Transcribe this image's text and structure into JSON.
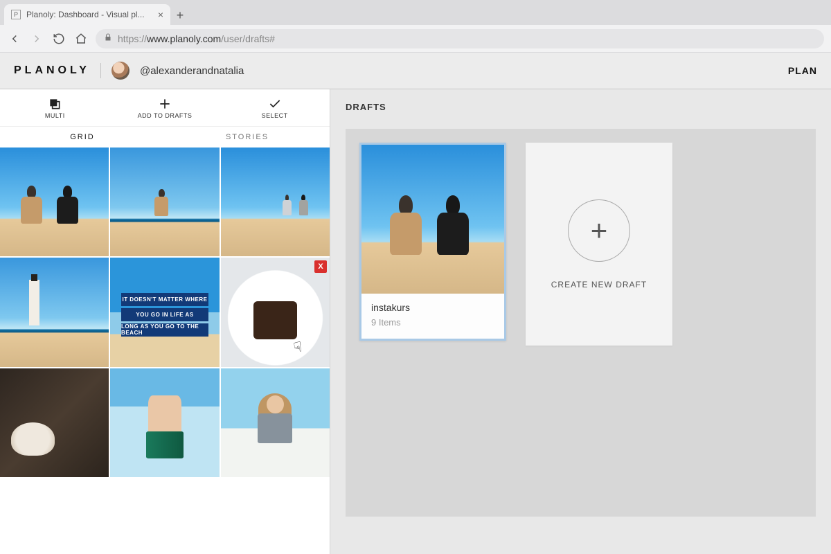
{
  "browser": {
    "tab_title": "Planoly: Dashboard - Visual pl...",
    "url_prefix": "https://",
    "url_host": "www.planoly.com",
    "url_path": "/user/drafts#"
  },
  "header": {
    "logo": "PLANOLY",
    "username": "@alexanderandnatalia",
    "nav_plan": "PLAN"
  },
  "actions": {
    "multi": "MULTI",
    "add": "ADD TO DRAFTS",
    "select": "SELECT"
  },
  "tabs": {
    "grid": "GRID",
    "stories": "STORIES"
  },
  "grid": {
    "quote_l1": "IT DOESN'T MATTER WHERE",
    "quote_l2": "YOU GO IN LIFE AS",
    "quote_l3": "LONG AS YOU GO TO THE BEACH",
    "delete_badge": "X"
  },
  "drafts": {
    "title": "DRAFTS",
    "items": [
      {
        "name": "instakurs",
        "count": "9 Items"
      }
    ],
    "create_label": "CREATE NEW DRAFT"
  }
}
